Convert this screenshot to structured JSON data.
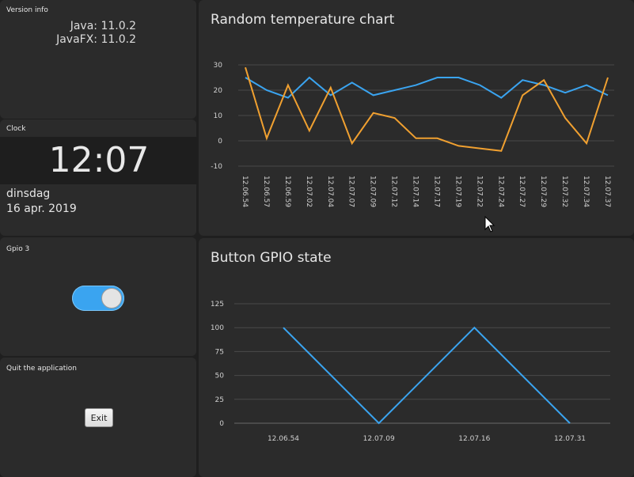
{
  "version_info": {
    "title": "Version info",
    "java": "Java: 11.0.2",
    "javafx": "JavaFX: 11.0.2"
  },
  "clock": {
    "title": "Clock",
    "time": "12:07",
    "day": "dinsdag",
    "date": "16 apr. 2019"
  },
  "gpio": {
    "title": "Gpio 3",
    "switch_on": true
  },
  "quit": {
    "title": "Quit the application",
    "exit_label": "Exit"
  },
  "colors": {
    "background": "#1f1f1f",
    "tile": "#2b2b2b",
    "series_blue": "#3aa4f0",
    "series_orange": "#f0a030"
  },
  "chart_data": [
    {
      "type": "line",
      "title": "Random temperature chart",
      "categories": [
        "12.06.54",
        "12.06.57",
        "12.06.59",
        "12.07.02",
        "12.07.04",
        "12.07.07",
        "12.07.09",
        "12.07.12",
        "12.07.14",
        "12.07.17",
        "12.07.19",
        "12.07.22",
        "12.07.24",
        "12.07.27",
        "12.07.29",
        "12.07.32",
        "12.07.34",
        "12.07.37"
      ],
      "series": [
        {
          "color": "#3aa4f0",
          "values": [
            25,
            20,
            17,
            25,
            18,
            23,
            18,
            20,
            22,
            25,
            25,
            22,
            17,
            24,
            22,
            19,
            22,
            18
          ]
        },
        {
          "color": "#f0a030",
          "values": [
            29,
            1,
            22,
            4,
            21,
            -1,
            11,
            9,
            1,
            1,
            -2,
            -3,
            -4,
            18,
            24,
            9,
            -1,
            25
          ]
        }
      ],
      "yticks": [
        30,
        20,
        10,
        0,
        -10
      ],
      "ylim": [
        -10,
        30
      ],
      "grid": true
    },
    {
      "type": "line",
      "title": "Button GPIO state",
      "x_ticks": [
        "12.06.54",
        "12.07.09",
        "12.07.16",
        "12.07.31"
      ],
      "series": [
        {
          "color": "#3aa4f0",
          "values": [
            100,
            0,
            100,
            0
          ]
        }
      ],
      "yticks": [
        125,
        100,
        75,
        50,
        25,
        0
      ],
      "ylim": [
        0,
        125
      ],
      "grid": true
    }
  ]
}
